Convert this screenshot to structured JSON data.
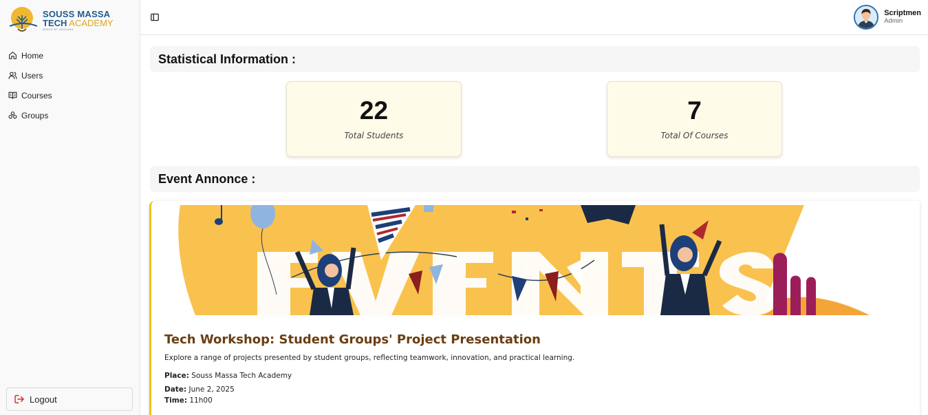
{
  "brand": {
    "line1": "SOUSS MASSA",
    "line2_a": "TECH",
    "line2_b": "ACADEMY",
    "line3": "WINGS BY JAOUARA"
  },
  "sidebar": {
    "items": [
      {
        "label": "Home",
        "icon": "home-icon"
      },
      {
        "label": "Users",
        "icon": "users-icon"
      },
      {
        "label": "Courses",
        "icon": "book-icon"
      },
      {
        "label": "Groups",
        "icon": "groups-icon"
      }
    ],
    "logout_label": "Logout"
  },
  "header": {
    "user_name": "Scriptmen",
    "user_role": "Admin"
  },
  "stats": {
    "title": "Statistical Information :",
    "cards": [
      {
        "value": "22",
        "label": "Total Students"
      },
      {
        "value": "7",
        "label": "Total Of Courses"
      }
    ]
  },
  "events": {
    "title": "Event Annonce :",
    "items": [
      {
        "title": "Tech Workshop: Student Groups' Project Presentation",
        "description": "Explore a range of projects presented by student groups, reflecting teamwork, innovation, and practical learning.",
        "place_label": "Place:",
        "place": "Souss Massa Tech Academy",
        "date_label": "Date:",
        "date": "June 2, 2025",
        "time_label": "Time:",
        "time": "11h00"
      }
    ]
  },
  "colors": {
    "accent": "#f0c419",
    "card_bg": "#fefbe9",
    "event_title": "#6b3e12",
    "banner_bg": "#f9c24e",
    "logout_icon": "#d32f2f",
    "brand_blue": "#1f5a8f",
    "brand_gold": "#e0a526"
  }
}
